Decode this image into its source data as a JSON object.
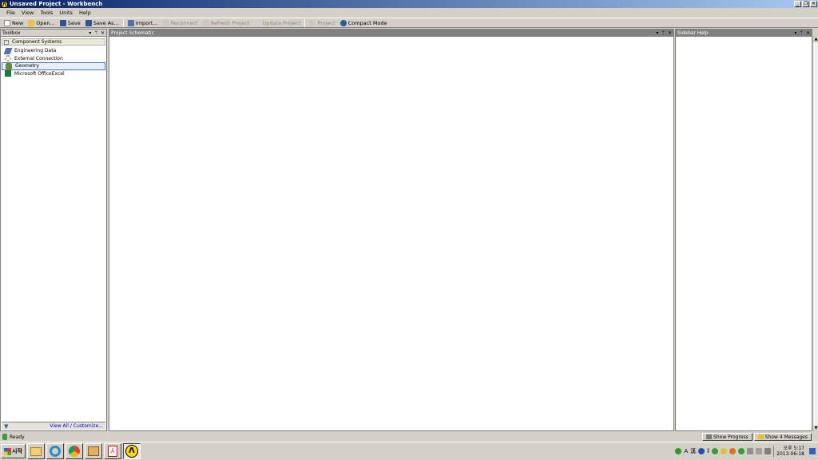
{
  "window": {
    "title": "Unsaved Project - Workbench",
    "app_icon_letter": "Λ"
  },
  "menu": [
    "File",
    "View",
    "Tools",
    "Units",
    "Help"
  ],
  "toolbar": {
    "new": "New",
    "open": "Open...",
    "save": "Save",
    "save_as": "Save As...",
    "import": "Import...",
    "reconnect": "Reconnect",
    "refresh": "Refresh Project",
    "update": "Update Project",
    "project": "Project",
    "compact": "Compact Mode"
  },
  "toolbox": {
    "title": "Toolbox",
    "group": "Component Systems",
    "items": [
      "Engineering Data",
      "External Connection",
      "Geometry",
      "Microsoft OfficeExcel"
    ],
    "selected_index": 2,
    "footer_link": "View All / Customize..."
  },
  "schematic": {
    "title": "Project Schematic"
  },
  "sidebar": {
    "title": "Sidebar Help"
  },
  "status": {
    "text": "Ready",
    "show_progress": "Show Progress",
    "show_messages": "Show 4 Messages"
  },
  "taskbar": {
    "start": "시작",
    "ime_a": "A",
    "ime_han": "漢",
    "clock_ampm": "오후 5:17",
    "clock_date": "2013-06-18"
  },
  "colors": {
    "title_start": "#0a246a",
    "title_end": "#a6caf0",
    "panel_header": "#808080"
  }
}
